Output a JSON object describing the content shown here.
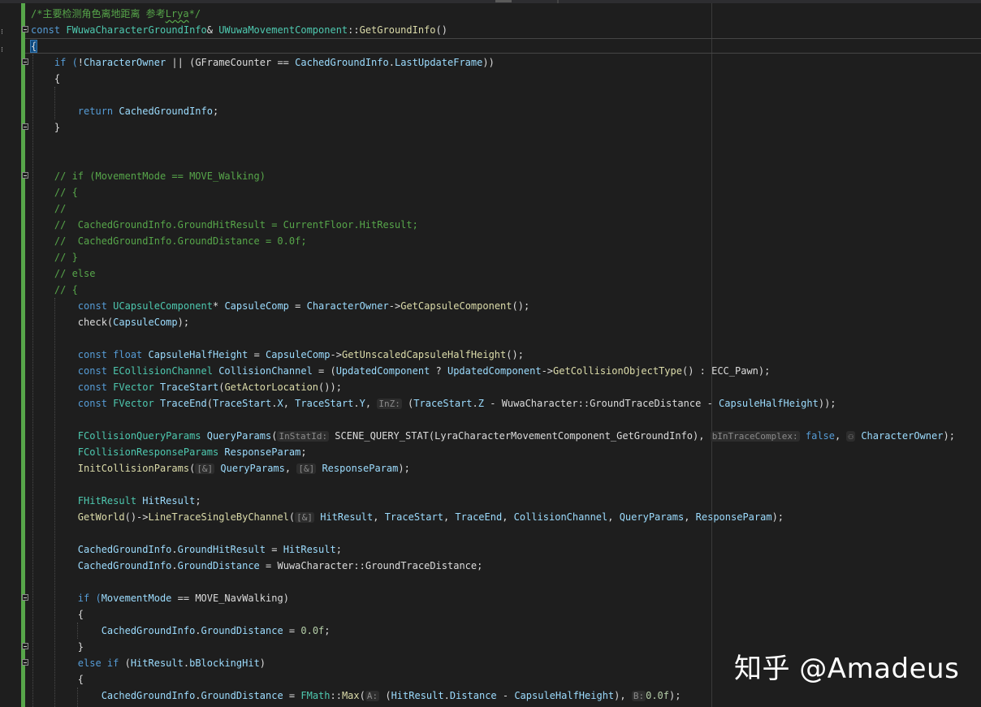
{
  "watermark": "知乎 @Amadeus",
  "colors": {
    "background": "#1e1e1e",
    "comment": "#57a64a",
    "keyword": "#569cd6",
    "type": "#4ec9b0",
    "variable": "#9cdcfe",
    "function": "#dcdcaa",
    "number": "#b5cea8",
    "change_bar": "#57a64a"
  },
  "code_lines": [
    [
      [
        "/*主要检测角色离地距离 参考",
        "comment"
      ],
      [
        "Lrya",
        "comment-squiggle"
      ],
      [
        "*/",
        "comment"
      ]
    ],
    [
      [
        "const ",
        "kw"
      ],
      [
        "FWuwaCharacterGroundInfo",
        "type"
      ],
      [
        "& ",
        "plain"
      ],
      [
        "UWuwaMovementComponent",
        "type"
      ],
      [
        "::",
        "plain"
      ],
      [
        "GetGroundInfo",
        "func"
      ],
      [
        "()",
        "plain"
      ]
    ],
    [
      [
        "{",
        "brace"
      ]
    ],
    [
      [
        "    if (",
        "plain-kw"
      ],
      [
        "!",
        "plain"
      ],
      [
        "CharacterOwner",
        "var"
      ],
      [
        " || (",
        "plain"
      ],
      [
        "GFrameCounter",
        "plain"
      ],
      [
        " == ",
        "plain"
      ],
      [
        "CachedGroundInfo",
        "var"
      ],
      [
        ".",
        "plain"
      ],
      [
        "LastUpdateFrame",
        "var"
      ],
      [
        "))",
        "plain"
      ]
    ],
    [
      [
        "    {",
        "plain"
      ]
    ],
    [
      [
        "",
        "plain"
      ]
    ],
    [
      [
        "        return ",
        "kw"
      ],
      [
        "CachedGroundInfo",
        "var"
      ],
      [
        ";",
        "plain"
      ]
    ],
    [
      [
        "    }",
        "plain"
      ]
    ],
    [
      [
        "",
        "plain"
      ]
    ],
    [
      [
        "",
        "plain"
      ]
    ],
    [
      [
        "    // if (MovementMode == MOVE_Walking)",
        "comment"
      ]
    ],
    [
      [
        "    // {",
        "comment"
      ]
    ],
    [
      [
        "    //",
        "comment"
      ]
    ],
    [
      [
        "    //  CachedGroundInfo.GroundHitResult = CurrentFloor.HitResult;",
        "comment"
      ]
    ],
    [
      [
        "    //  CachedGroundInfo.GroundDistance = 0.0f;",
        "comment"
      ]
    ],
    [
      [
        "    // }",
        "comment"
      ]
    ],
    [
      [
        "    // else",
        "comment"
      ]
    ],
    [
      [
        "    // {",
        "comment"
      ]
    ],
    [
      [
        "        const ",
        "kw"
      ],
      [
        "UCapsuleComponent",
        "type"
      ],
      [
        "* ",
        "plain"
      ],
      [
        "CapsuleComp",
        "var"
      ],
      [
        " = ",
        "plain"
      ],
      [
        "CharacterOwner",
        "var"
      ],
      [
        "->",
        "plain"
      ],
      [
        "GetCapsuleComponent",
        "func"
      ],
      [
        "();",
        "plain"
      ]
    ],
    [
      [
        "        check",
        "plain"
      ],
      [
        "(",
        "plain"
      ],
      [
        "CapsuleComp",
        "var"
      ],
      [
        ");",
        "plain"
      ]
    ],
    [
      [
        "",
        "plain"
      ]
    ],
    [
      [
        "        const ",
        "kw"
      ],
      [
        "float ",
        "kw"
      ],
      [
        "CapsuleHalfHeight",
        "var"
      ],
      [
        " = ",
        "plain"
      ],
      [
        "CapsuleComp",
        "var"
      ],
      [
        "->",
        "plain"
      ],
      [
        "GetUnscaledCapsuleHalfHeight",
        "func"
      ],
      [
        "();",
        "plain"
      ]
    ],
    [
      [
        "        const ",
        "kw"
      ],
      [
        "ECollisionChannel ",
        "type"
      ],
      [
        "CollisionChannel",
        "var"
      ],
      [
        " = (",
        "plain"
      ],
      [
        "UpdatedComponent",
        "var"
      ],
      [
        " ? ",
        "plain"
      ],
      [
        "UpdatedComponent",
        "var"
      ],
      [
        "->",
        "plain"
      ],
      [
        "GetCollisionObjectType",
        "func"
      ],
      [
        "() : ",
        "plain"
      ],
      [
        "ECC_Pawn",
        "plain"
      ],
      [
        ");",
        "plain"
      ]
    ],
    [
      [
        "        const ",
        "kw"
      ],
      [
        "FVector ",
        "type"
      ],
      [
        "TraceStart",
        "var"
      ],
      [
        "(",
        "plain"
      ],
      [
        "GetActorLocation",
        "func"
      ],
      [
        "());",
        "plain"
      ]
    ],
    [
      [
        "        const ",
        "kw"
      ],
      [
        "FVector ",
        "type"
      ],
      [
        "TraceEnd",
        "var"
      ],
      [
        "(",
        "plain"
      ],
      [
        "TraceStart",
        "var"
      ],
      [
        ".",
        "plain"
      ],
      [
        "X",
        "var"
      ],
      [
        ", ",
        "plain"
      ],
      [
        "TraceStart",
        "var"
      ],
      [
        ".",
        "plain"
      ],
      [
        "Y",
        "var"
      ],
      [
        ", ",
        "plain"
      ],
      [
        "InZ:",
        "hint"
      ],
      [
        " (",
        "plain"
      ],
      [
        "TraceStart",
        "var"
      ],
      [
        ".",
        "plain"
      ],
      [
        "Z",
        "var"
      ],
      [
        " - ",
        "plain"
      ],
      [
        "WuwaCharacter",
        "plain"
      ],
      [
        "::",
        "plain"
      ],
      [
        "GroundTraceDistance",
        "plain"
      ],
      [
        " - ",
        "plain"
      ],
      [
        "CapsuleHalfHeight",
        "var"
      ],
      [
        "));",
        "plain"
      ]
    ],
    [
      [
        "",
        "plain"
      ]
    ],
    [
      [
        "        FCollisionQueryParams ",
        "type"
      ],
      [
        "QueryParams",
        "var"
      ],
      [
        "(",
        "plain"
      ],
      [
        "InStatId:",
        "hint"
      ],
      [
        " SCENE_QUERY_STAT",
        "plain"
      ],
      [
        "(LyraCharacterMovementComponent_GetGroundInfo), ",
        "plain"
      ],
      [
        "bInTraceComplex:",
        "hint"
      ],
      [
        " false",
        "kw"
      ],
      [
        ", ",
        "plain"
      ],
      [
        "⚇",
        "hint"
      ],
      [
        " CharacterOwner",
        "var"
      ],
      [
        ");",
        "plain"
      ]
    ],
    [
      [
        "        FCollisionResponseParams ",
        "type"
      ],
      [
        "ResponseParam",
        "var"
      ],
      [
        ";",
        "plain"
      ]
    ],
    [
      [
        "        InitCollisionParams",
        "func"
      ],
      [
        "(",
        "plain"
      ],
      [
        "[&]",
        "hint"
      ],
      [
        " QueryParams",
        "var"
      ],
      [
        ", ",
        "plain"
      ],
      [
        "[&]",
        "hint"
      ],
      [
        " ResponseParam",
        "var"
      ],
      [
        ");",
        "plain"
      ]
    ],
    [
      [
        "",
        "plain"
      ]
    ],
    [
      [
        "        FHitResult ",
        "type"
      ],
      [
        "HitResult",
        "var"
      ],
      [
        ";",
        "plain"
      ]
    ],
    [
      [
        "        GetWorld",
        "func"
      ],
      [
        "()->",
        "plain"
      ],
      [
        "LineTraceSingleByChannel",
        "func"
      ],
      [
        "(",
        "plain"
      ],
      [
        "[&]",
        "hint"
      ],
      [
        " HitResult",
        "var"
      ],
      [
        ", ",
        "plain"
      ],
      [
        "TraceStart",
        "var"
      ],
      [
        ", ",
        "plain"
      ],
      [
        "TraceEnd",
        "var"
      ],
      [
        ", ",
        "plain"
      ],
      [
        "CollisionChannel",
        "var"
      ],
      [
        ", ",
        "plain"
      ],
      [
        "QueryParams",
        "var"
      ],
      [
        ", ",
        "plain"
      ],
      [
        "ResponseParam",
        "var"
      ],
      [
        ");",
        "plain"
      ]
    ],
    [
      [
        "",
        "plain"
      ]
    ],
    [
      [
        "        CachedGroundInfo",
        "var"
      ],
      [
        ".",
        "plain"
      ],
      [
        "GroundHitResult",
        "var"
      ],
      [
        " = ",
        "plain"
      ],
      [
        "HitResult",
        "var"
      ],
      [
        ";",
        "plain"
      ]
    ],
    [
      [
        "        CachedGroundInfo",
        "var"
      ],
      [
        ".",
        "plain"
      ],
      [
        "GroundDistance",
        "var"
      ],
      [
        " = ",
        "plain"
      ],
      [
        "WuwaCharacter",
        "plain"
      ],
      [
        "::",
        "plain"
      ],
      [
        "GroundTraceDistance",
        "plain"
      ],
      [
        ";",
        "plain"
      ]
    ],
    [
      [
        "",
        "plain"
      ]
    ],
    [
      [
        "        if (",
        "kw"
      ],
      [
        "MovementMode",
        "var"
      ],
      [
        " == ",
        "plain"
      ],
      [
        "MOVE_NavWalking",
        "plain"
      ],
      [
        ")",
        "plain"
      ]
    ],
    [
      [
        "        {",
        "plain"
      ]
    ],
    [
      [
        "            CachedGroundInfo",
        "var"
      ],
      [
        ".",
        "plain"
      ],
      [
        "GroundDistance",
        "var"
      ],
      [
        " = ",
        "plain"
      ],
      [
        "0.0f",
        "num"
      ],
      [
        ";",
        "plain"
      ]
    ],
    [
      [
        "        }",
        "plain"
      ]
    ],
    [
      [
        "        else if ",
        "kw"
      ],
      [
        "(",
        "plain"
      ],
      [
        "HitResult",
        "var"
      ],
      [
        ".",
        "plain"
      ],
      [
        "bBlockingHit",
        "var"
      ],
      [
        ")",
        "plain"
      ]
    ],
    [
      [
        "        {",
        "plain"
      ]
    ],
    [
      [
        "            CachedGroundInfo",
        "var"
      ],
      [
        ".",
        "plain"
      ],
      [
        "GroundDistance",
        "var"
      ],
      [
        " = ",
        "plain"
      ],
      [
        "FMath",
        "type"
      ],
      [
        "::",
        "plain"
      ],
      [
        "Max",
        "func"
      ],
      [
        "(",
        "plain"
      ],
      [
        "A:",
        "hint"
      ],
      [
        " (",
        "plain"
      ],
      [
        "HitResult",
        "var"
      ],
      [
        ".",
        "plain"
      ],
      [
        "Distance",
        "var"
      ],
      [
        " - ",
        "plain"
      ],
      [
        "CapsuleHalfHeight",
        "var"
      ],
      [
        "), ",
        "plain"
      ],
      [
        "B:",
        "hint"
      ],
      [
        "0.0f",
        "num"
      ],
      [
        ");",
        "plain"
      ]
    ]
  ]
}
